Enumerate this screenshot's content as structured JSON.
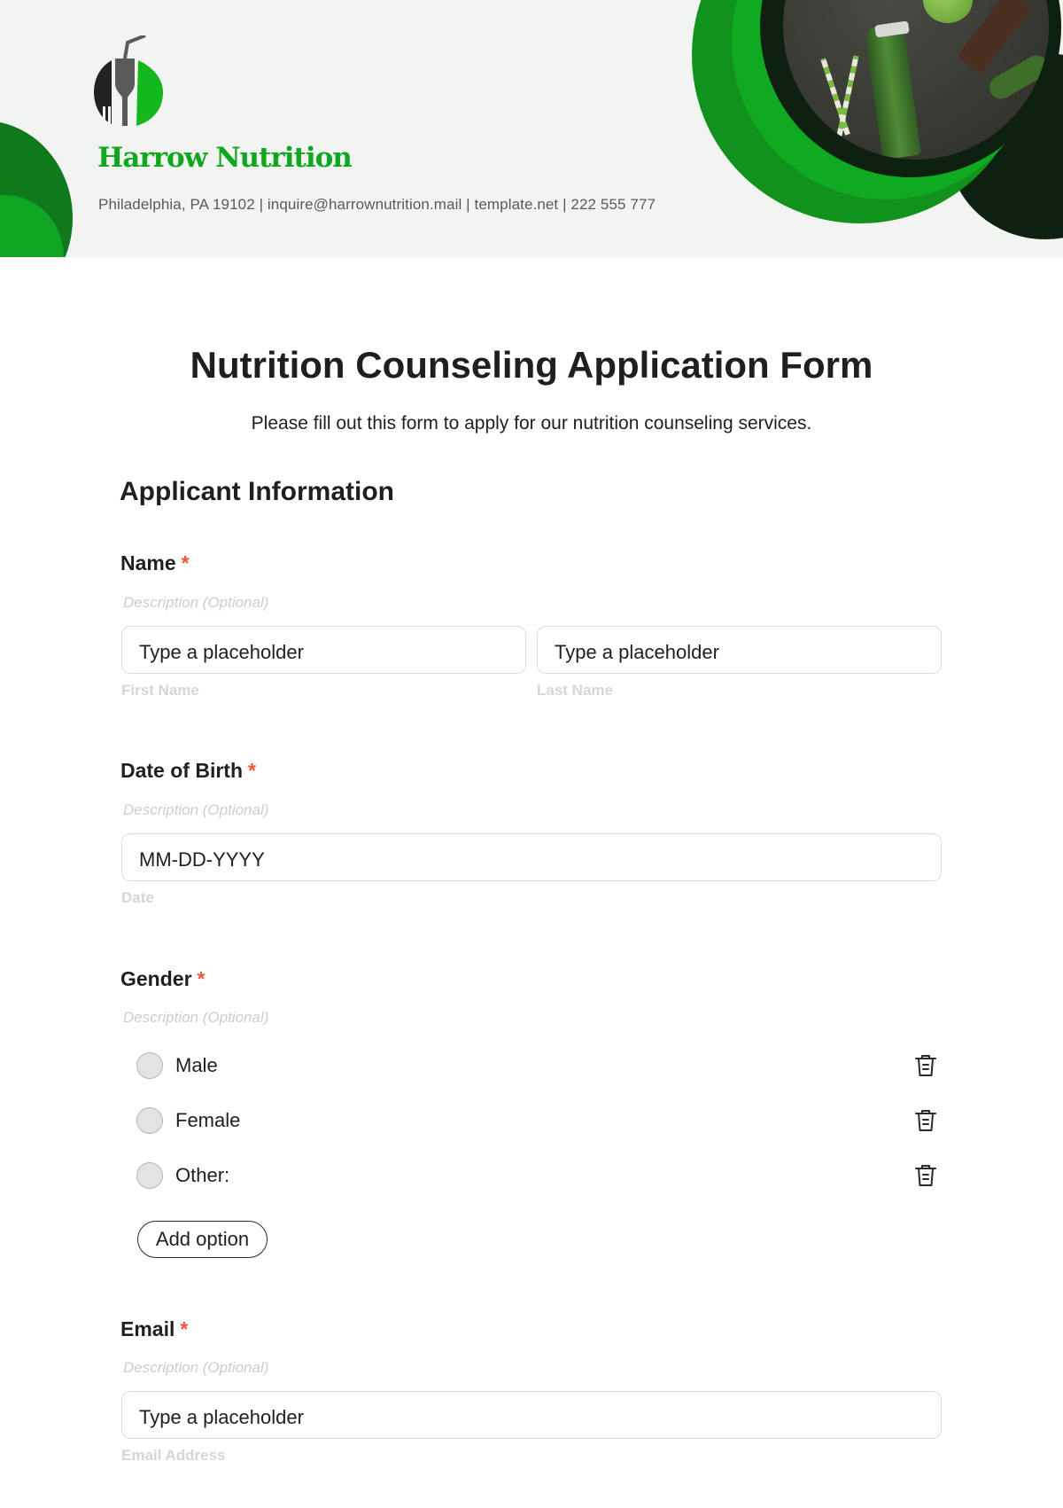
{
  "header": {
    "brand_name": "Harrow Nutrition",
    "contact_line": "Philadelphia, PA 19102 | inquire@harrownutrition.mail | template.net | 222 555 777",
    "logo_icon": "fork-cup-straw-logo",
    "colors": {
      "brand_green": "#11a61f",
      "dark_green": "#0e200f",
      "mid_green": "#10791c"
    }
  },
  "form": {
    "title": "Nutrition Counseling Application Form",
    "subtitle": "Please fill out this form to apply for our nutrition counseling services.",
    "section_heading": "Applicant Information",
    "required_marker": "*",
    "fields": {
      "name": {
        "label": "Name",
        "description": "Description (Optional)",
        "first": {
          "placeholder": "Type a placeholder",
          "sublabel": "First Name"
        },
        "last": {
          "placeholder": "Type a placeholder",
          "sublabel": "Last Name"
        }
      },
      "dob": {
        "label": "Date of Birth",
        "description": "Description (Optional)",
        "placeholder": "MM-DD-YYYY",
        "sublabel": "Date"
      },
      "gender": {
        "label": "Gender",
        "description": "Description (Optional)",
        "options": [
          {
            "label": "Male",
            "selected": false
          },
          {
            "label": "Female",
            "selected": false
          },
          {
            "label": "Other:",
            "selected": false
          }
        ],
        "add_option_label": "Add option",
        "delete_icon": "trash-icon"
      },
      "email": {
        "label": "Email",
        "description": "Description (Optional)",
        "placeholder": "Type a placeholder",
        "sublabel": "Email Address"
      }
    }
  }
}
